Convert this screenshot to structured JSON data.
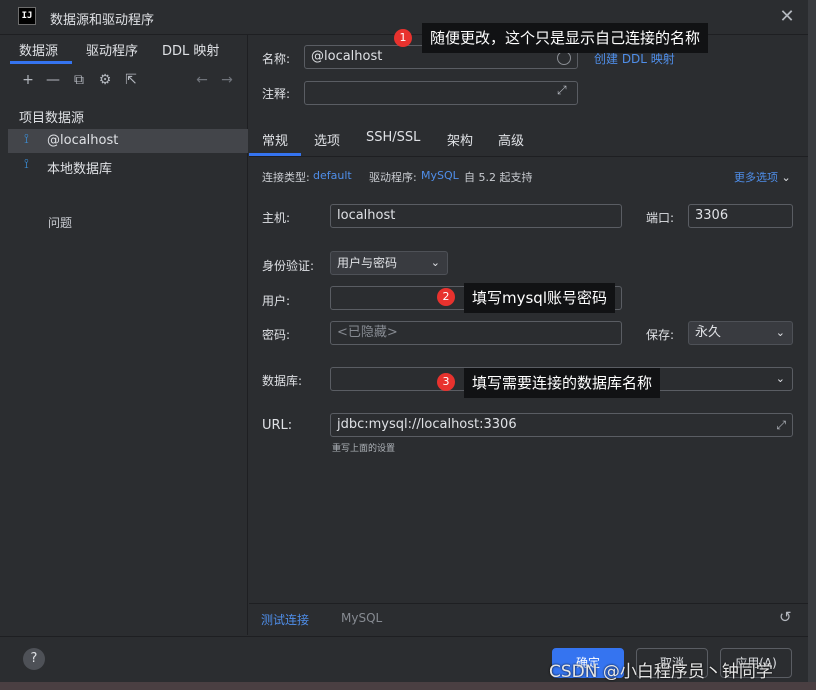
{
  "window": {
    "icon_text": "IJ",
    "title": "数据源和驱动程序"
  },
  "left": {
    "tabs": [
      "数据源",
      "驱动程序",
      "DDL 映射"
    ],
    "toolbar": [
      {
        "icon": "plus-icon",
        "glyph": "+"
      },
      {
        "icon": "minus-icon",
        "glyph": "—"
      },
      {
        "icon": "copy-icon",
        "glyph": "⧉"
      },
      {
        "icon": "settings-icon",
        "glyph": "⚙"
      },
      {
        "icon": "export-icon",
        "glyph": "⇱"
      },
      {
        "icon": "back-arrow-icon",
        "glyph": "←"
      },
      {
        "icon": "forward-arrow-icon",
        "glyph": "→"
      }
    ],
    "section": "项目数据源",
    "items": [
      {
        "label": "@localhost"
      },
      {
        "label": "本地数据库"
      }
    ],
    "problems": "问题"
  },
  "right": {
    "name_label": "名称:",
    "name_value": "@localhost",
    "create_ddl": "创建 DDL 映射",
    "comment_label": "注释:",
    "tabs": [
      "常规",
      "选项",
      "SSH/SSL",
      "架构",
      "高级"
    ],
    "conn_type_label": "连接类型:",
    "conn_type_value": "default",
    "driver_label": "驱动程序:",
    "driver_value": "MySQL",
    "driver_support": "自 5.2 起支持",
    "more_options": "更多选项",
    "host_label": "主机:",
    "host_value": "localhost",
    "port_label": "端口:",
    "port_value": "3306",
    "auth_label": "身份验证:",
    "auth_value": "用户与密码",
    "user_label": "用户:",
    "password_label": "密码:",
    "password_placeholder": "<已隐藏>",
    "save_label": "保存:",
    "save_value": "永久",
    "database_label": "数据库:",
    "url_label": "URL:",
    "url_value": "jdbc:mysql://localhost:3306",
    "url_hint": "重写上面的设置",
    "test_connection": "测试连接",
    "driver_footer": "MySQL"
  },
  "footer": {
    "help": "?",
    "ok": "确定",
    "cancel": "取消",
    "apply": "应用(A)"
  },
  "annotations": [
    {
      "num": "1",
      "text": "随便更改，这个只是显示自己连接的名称"
    },
    {
      "num": "2",
      "text": "填写mysql账号密码"
    },
    {
      "num": "3",
      "text": "填写需要连接的数据库名称"
    }
  ],
  "watermark": "CSDN @小白程序员丶钟同学",
  "colors": {
    "accent": "#3574f0",
    "badge": "#e8322e",
    "link": "#4f8ee9"
  }
}
